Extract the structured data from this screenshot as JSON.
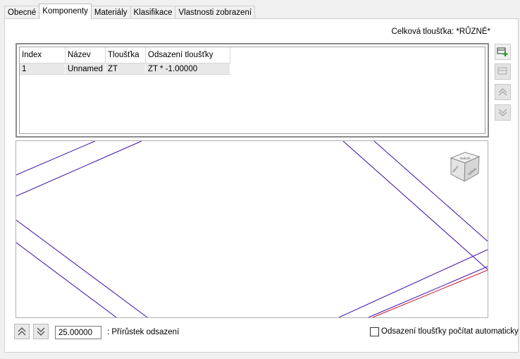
{
  "tabs": [
    "Obecné",
    "Komponenty",
    "Materiály",
    "Klasifikace",
    "Vlastnosti zobrazení"
  ],
  "total_thickness": "Celková tloušťka: *RŮZNÉ*",
  "grid": {
    "columns": [
      "Index",
      "Název",
      "Tloušťka",
      "Odsazení tloušťky"
    ],
    "rows": [
      [
        "1",
        "Unnamed",
        "ZT",
        "ZT * -1.00000"
      ]
    ]
  },
  "side_buttons": [
    "add-component-icon",
    "remove-component-icon",
    "move-up-icon",
    "move-down-icon"
  ],
  "viewcube": {
    "top_label": "Nahoře",
    "left_label": "Vlevo",
    "right_label": "Vpředu"
  },
  "bottom": {
    "increment_value": "25.00000",
    "increment_label": ": Přírůstek odsazení",
    "auto_offset_label": "Odsazení tloušťky počítat automaticky",
    "auto_offset_checked": false
  },
  "colors": {
    "preview_line": "#3b0aa6",
    "preview_red": "#c8102e"
  }
}
